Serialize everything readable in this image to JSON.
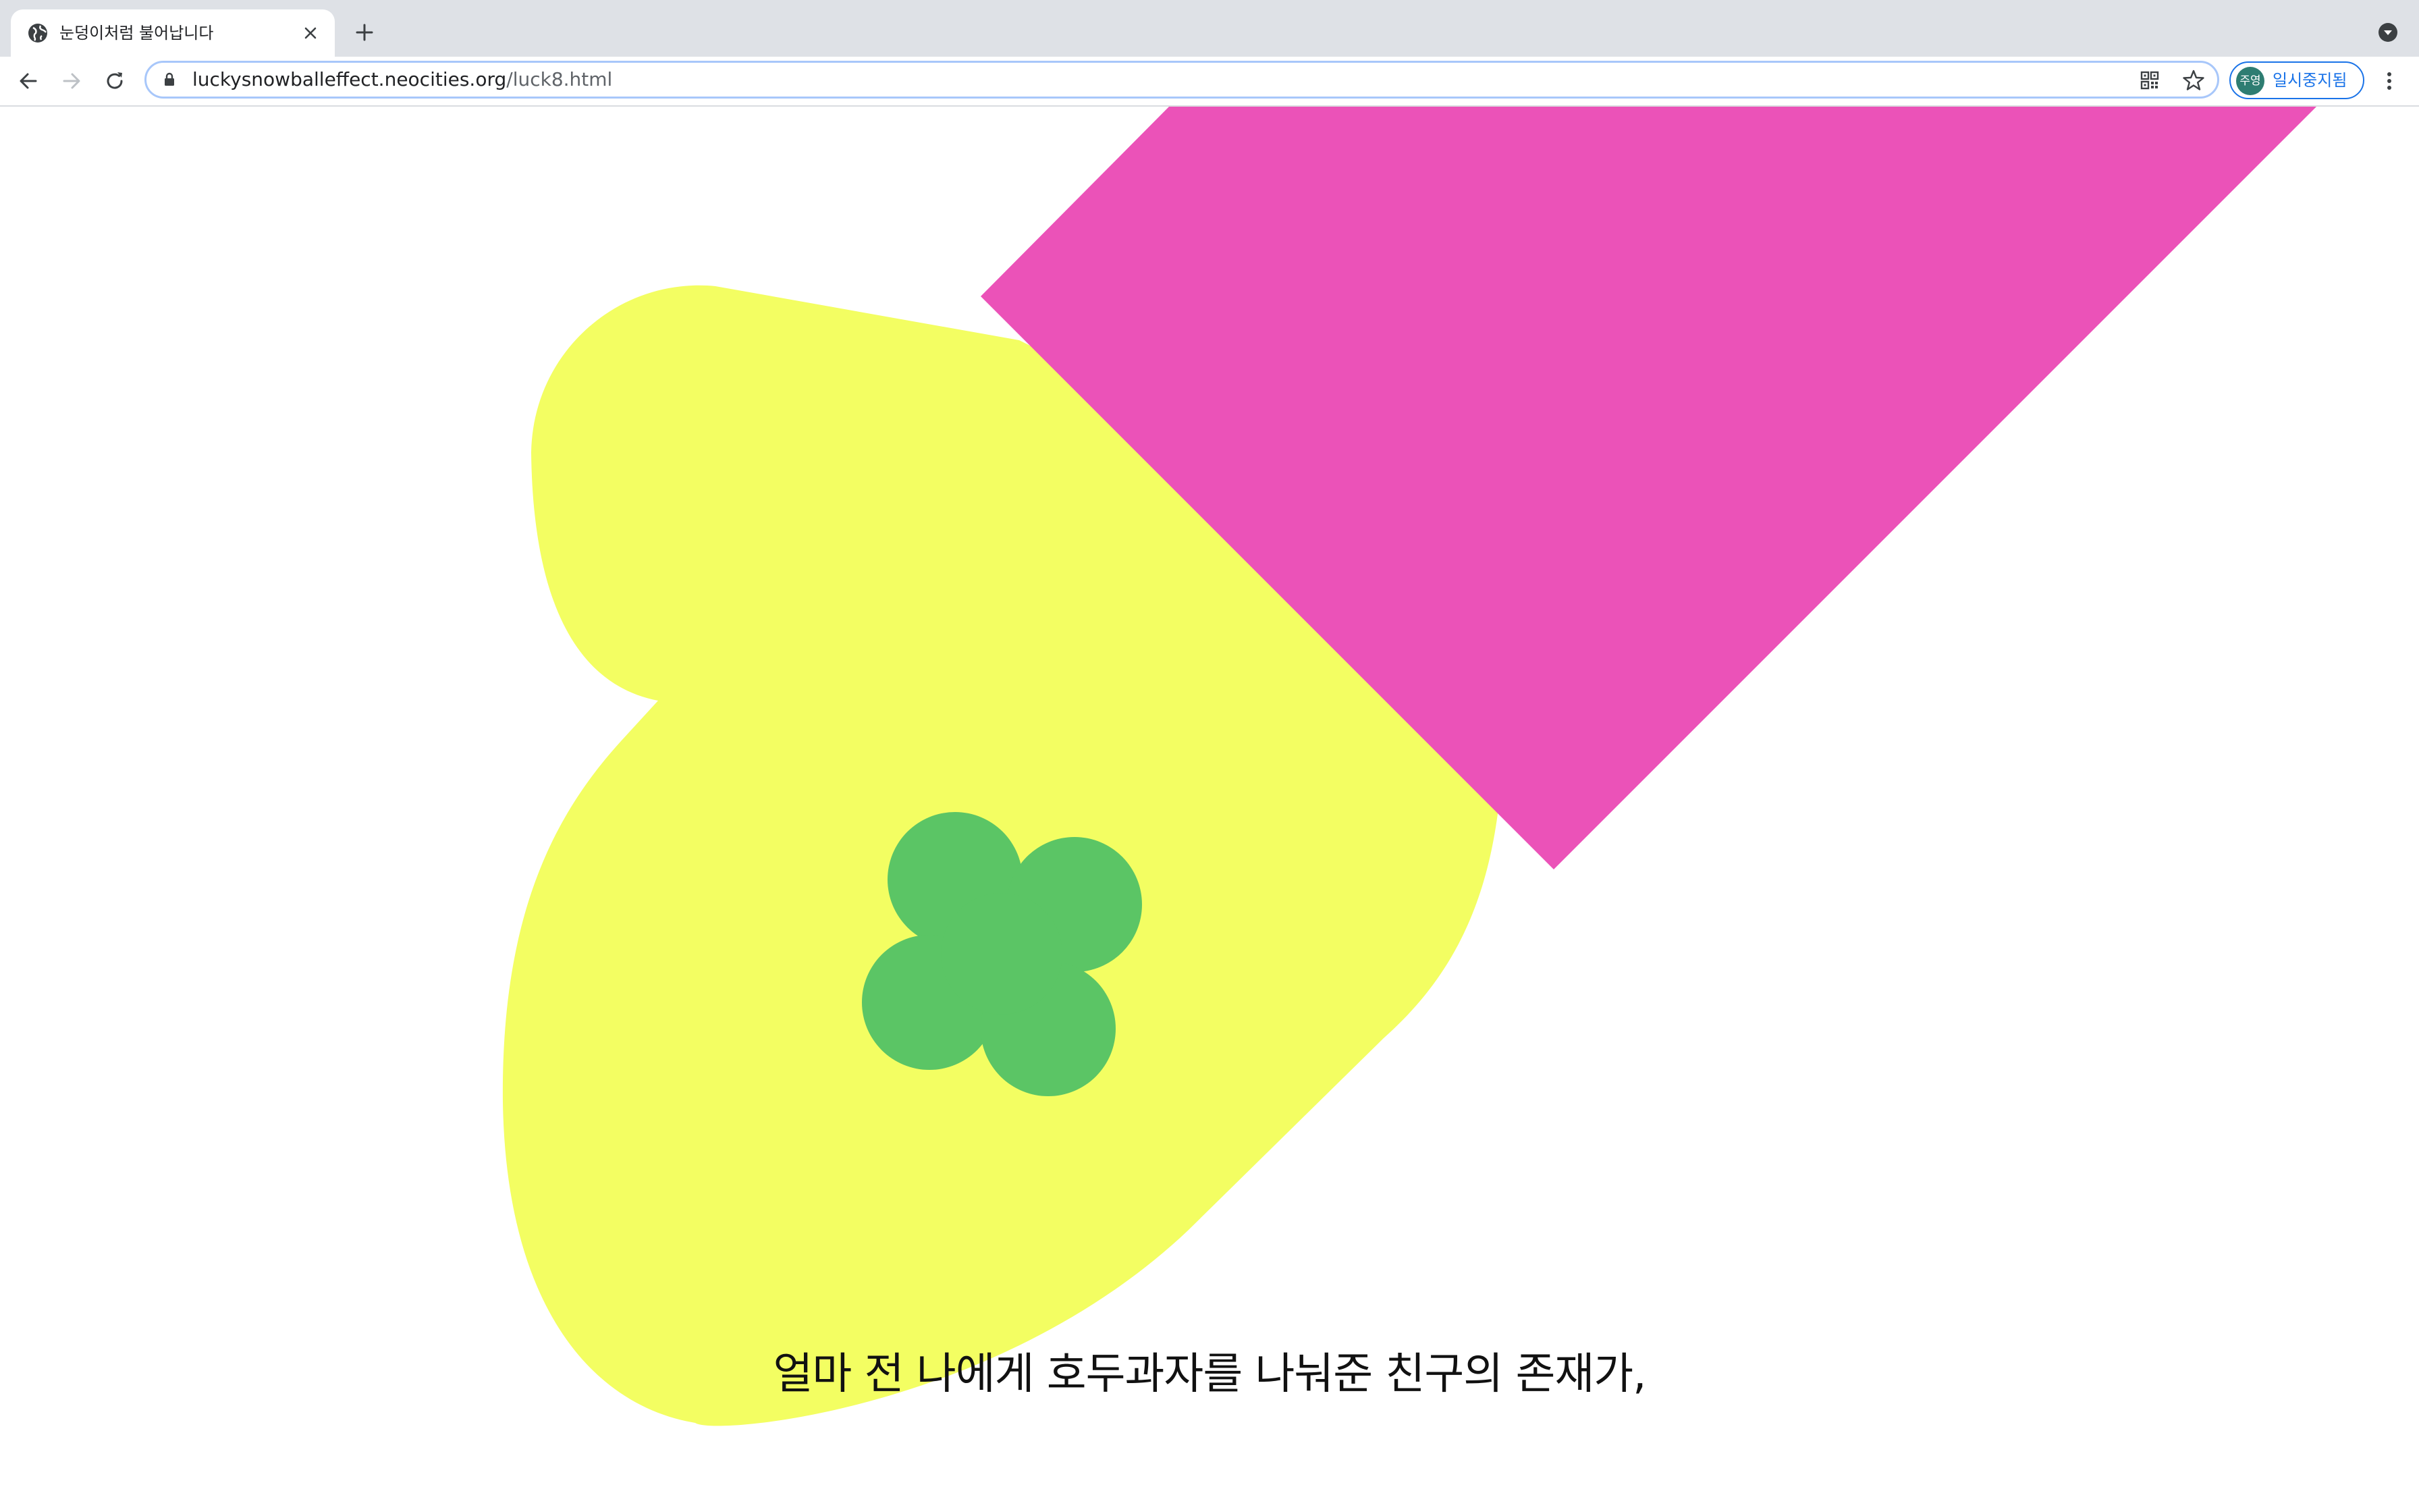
{
  "browser": {
    "tab": {
      "title": "눈덩이처럼 불어납니다",
      "favicon": "globe-icon"
    },
    "new_tab_icon": "plus-icon",
    "tab_search_icon": "chevron-down-circle-icon",
    "nav": {
      "back_icon": "arrow-left-icon",
      "forward_icon": "arrow-right-icon",
      "reload_icon": "reload-icon"
    },
    "address": {
      "lock_icon": "lock-icon",
      "host": "luckysnowballeffect.neocities.org",
      "path": "/luck8.html",
      "qr_icon": "qr-code-icon",
      "bookmark_icon": "star-icon"
    },
    "profile": {
      "avatar_text": "주영",
      "status": "일시중지됨"
    },
    "menu_icon": "kebab-menu-icon"
  },
  "page": {
    "caption": "얼마 전 나에게 호두과자를 나눠준 친구의 존재가,",
    "colors": {
      "yellow_shape": "#f3fe62",
      "pink_shape": "#eb52b8",
      "green_clover": "#5bc565",
      "background": "#ffffff"
    }
  }
}
